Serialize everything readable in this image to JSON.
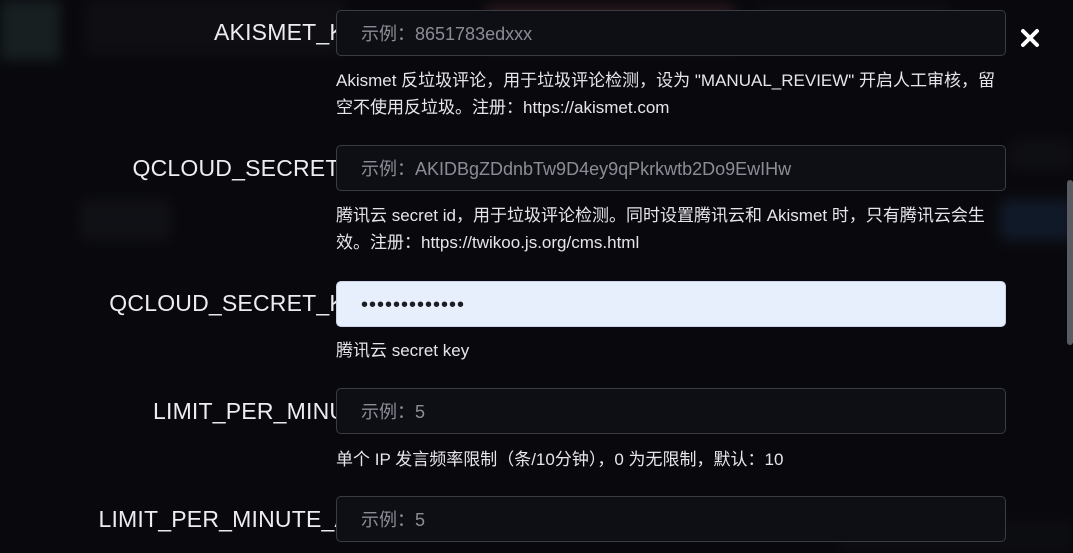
{
  "fields": [
    {
      "label": "AKISMET_KEY",
      "placeholder": "示例：8651783edxxx",
      "value": "",
      "help": "Akismet 反垃圾评论，用于垃圾评论检测，设为 \"MANUAL_REVIEW\" 开启人工审核，留空不使用反垃圾。注册：https://akismet.com"
    },
    {
      "label": "QCLOUD_SECRET_ID",
      "placeholder": "示例：AKIDBgZDdnbTw9D4ey9qPkrkwtb2Do9EwIHw",
      "value": "",
      "help": "腾讯云 secret id，用于垃圾评论检测。同时设置腾讯云和 Akismet 时，只有腾讯云会生效。注册：https://twikoo.js.org/cms.html"
    },
    {
      "label": "QCLOUD_SECRET_KEY",
      "placeholder": "",
      "value": "•••••••••••••",
      "help": "腾讯云 secret key"
    },
    {
      "label": "LIMIT_PER_MINUTE",
      "placeholder": "示例：5",
      "value": "",
      "help": "单个 IP 发言频率限制（条/10分钟），0 为无限制，默认：10"
    },
    {
      "label": "LIMIT_PER_MINUTE_ALL",
      "placeholder": "示例：5",
      "value": ""
    }
  ],
  "close_icon": "close-icon",
  "colors": {
    "background": "#0b0c10",
    "filled_input": "#e8effc",
    "text": "#ececf1"
  }
}
